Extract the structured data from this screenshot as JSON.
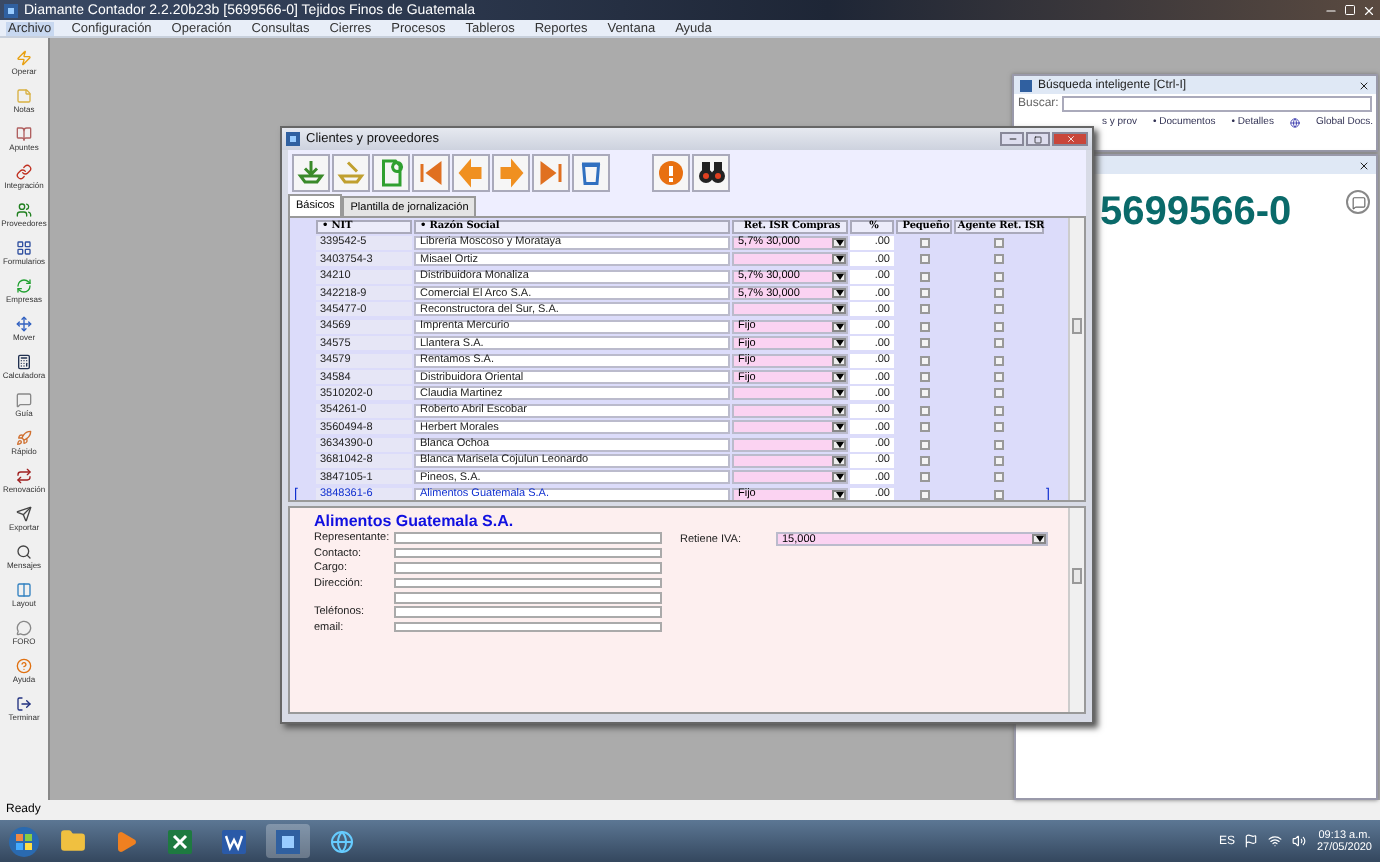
{
  "window": {
    "title": "Diamante Contador 2.2.20b23b [5699566-0] Tejidos Finos de Guatemala"
  },
  "menu": [
    {
      "label": "Archivo",
      "selected": true
    },
    {
      "label": "Configuración",
      "selected": false
    },
    {
      "label": "Operación",
      "selected": false
    },
    {
      "label": "Consultas",
      "selected": false
    },
    {
      "label": "Cierres",
      "selected": false
    },
    {
      "label": "Procesos",
      "selected": false
    },
    {
      "label": "Tableros",
      "selected": false
    },
    {
      "label": "Reportes",
      "selected": false
    },
    {
      "label": "Ventana",
      "selected": false
    },
    {
      "label": "Ayuda",
      "selected": false
    }
  ],
  "sidebar": {
    "items": [
      {
        "label": "Operar"
      },
      {
        "label": "Notas"
      },
      {
        "label": "Apuntes"
      },
      {
        "label": "Integración"
      },
      {
        "label": "Proveedores"
      },
      {
        "label": "Formularios"
      },
      {
        "label": "Empresas"
      },
      {
        "label": "Mover"
      },
      {
        "label": "Calculadora"
      },
      {
        "label": "Guía"
      },
      {
        "label": "Rápido"
      },
      {
        "label": "Renovación"
      },
      {
        "label": "Exportar"
      },
      {
        "label": "Mensajes"
      },
      {
        "label": "Layout"
      },
      {
        "label": "FORO"
      },
      {
        "label": "Ayuda"
      },
      {
        "label": "Terminar"
      }
    ]
  },
  "search_panel": {
    "title": "Búsqueda inteligente [Ctrl-I]",
    "label": "Buscar:",
    "links": [
      "s y prov",
      "• Documentos",
      "• Detalles",
      "Global Docs."
    ]
  },
  "info_panel": {
    "nit": "5699566-0"
  },
  "dialog": {
    "title": "Clientes y proveedores",
    "tabs": [
      {
        "label": "Básicos",
        "selected": true
      },
      {
        "label": "Plantilla de jornalización",
        "selected": false
      }
    ],
    "grid": {
      "columns": [
        "NIT",
        "Razón Social",
        "Ret. ISR Compras",
        "%",
        "Pequeño",
        "Agente Ret. ISR"
      ],
      "sort_mark": "•",
      "selection_marks": {
        "open": "[",
        "close": "]"
      },
      "rows": [
        {
          "nit": "339542-5",
          "name": "Libreria Moscoso y Morataya",
          "isr": "5,7% 30,000",
          "pct": ".00",
          "pequeno": false,
          "agente": false,
          "selected": false
        },
        {
          "nit": "3403754-3",
          "name": "Misael Ortiz",
          "pct": ".00",
          "pequeno": false,
          "agente": false,
          "selected": false
        },
        {
          "nit": "34210",
          "name": "Distribuidora Monaliza",
          "isr": "5,7% 30,000",
          "pct": ".00",
          "pequeno": false,
          "agente": false,
          "selected": false
        },
        {
          "nit": "342218-9",
          "name": "Comercial El Arco S.A.",
          "isr": "5,7% 30,000",
          "pct": ".00",
          "pequeno": false,
          "agente": false,
          "selected": false
        },
        {
          "nit": "345477-0",
          "name": "Reconstructora del Sur, S.A.",
          "pct": ".00",
          "pequeno": false,
          "agente": false,
          "selected": false
        },
        {
          "nit": "34569",
          "name": "Imprenta Mercurio",
          "isr": "Fijo",
          "pct": ".00",
          "pequeno": false,
          "agente": false,
          "selected": false
        },
        {
          "nit": "34575",
          "name": "Llantera S.A.",
          "isr": "Fijo",
          "pct": ".00",
          "pequeno": false,
          "agente": false,
          "selected": false
        },
        {
          "nit": "34579",
          "name": "Rentamos S.A.",
          "isr": "Fijo",
          "pct": ".00",
          "pequeno": false,
          "agente": false,
          "selected": false
        },
        {
          "nit": "34584",
          "name": "Distribuidora Oriental",
          "isr": "Fijo",
          "pct": ".00",
          "pequeno": false,
          "agente": false,
          "selected": false
        },
        {
          "nit": "3510202-0",
          "name": "Claudia Martinez",
          "pct": ".00",
          "pequeno": false,
          "agente": false,
          "selected": false
        },
        {
          "nit": "354261-0",
          "name": "Roberto Abril Escobar",
          "pct": ".00",
          "pequeno": false,
          "agente": false,
          "selected": false
        },
        {
          "nit": "3560494-8",
          "name": "Herbert Morales",
          "pct": ".00",
          "pequeno": false,
          "agente": false,
          "selected": false
        },
        {
          "nit": "3634390-0",
          "name": "Blanca Ochoa",
          "pct": ".00",
          "pequeno": false,
          "agente": false,
          "selected": false
        },
        {
          "nit": "3681042-8",
          "name": "Blanca Marisela Cojulun Leonardo",
          "pct": ".00",
          "pequeno": false,
          "agente": false,
          "selected": false
        },
        {
          "nit": "3847105-1",
          "name": "Pineos, S.A.",
          "pct": ".00",
          "pequeno": false,
          "agente": false,
          "selected": false
        },
        {
          "nit": "3848361-6",
          "name": "Alimentos Guatemala S.A.",
          "isr": "Fijo",
          "pct": ".00",
          "pequeno": false,
          "agente": false,
          "selected": true
        }
      ]
    },
    "form": {
      "heading": "Alimentos Guatemala S.A.",
      "fields": [
        {
          "label": "Representante:",
          "kind": "single"
        },
        {
          "label": "Contacto:",
          "kind": "single"
        },
        {
          "label": "Cargo:",
          "kind": "single"
        },
        {
          "label": "Dirección:",
          "kind": "double"
        },
        {
          "label": "Teléfonos:",
          "kind": "single"
        },
        {
          "label": "email:",
          "kind": "single"
        }
      ],
      "retiene_iva": {
        "label": "Retiene IVA:",
        "value": "15,000"
      }
    }
  },
  "status_bar": "Ready",
  "taskbar": {
    "language": "ES",
    "time": "09:13 a.m.",
    "date": "27/05/2020"
  }
}
